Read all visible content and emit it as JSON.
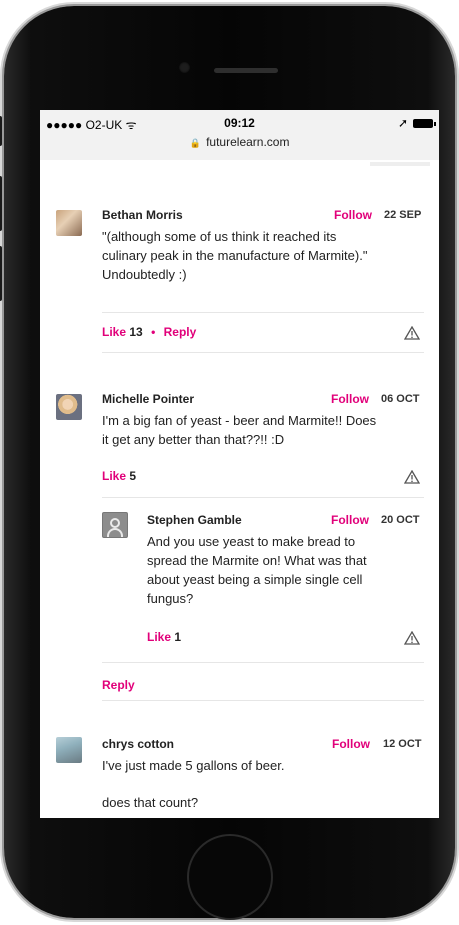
{
  "statusbar": {
    "carrier": "●●●●● O2-UK ᯤ",
    "time": "09:12",
    "location_arrow": "➚",
    "url": "futurelearn.com",
    "lock_icon": "lock-icon"
  },
  "comments": [
    {
      "name": "Bethan Morris",
      "follow": "Follow",
      "date": "22 SEP",
      "line1": "\"(although some of us think it reached its",
      "line2": "culinary peak in the manufacture of Marmite).\"",
      "line3": "Undoubtedly :)",
      "like": "Like",
      "like_count": "13",
      "reply": "Reply"
    },
    {
      "name": "Michelle Pointer",
      "follow": "Follow",
      "date": "06 OCT",
      "line1": "I'm a big fan of yeast - beer and Marmite!! Does",
      "line2": "it get any better than that??!! :D",
      "like": "Like",
      "like_count": "5",
      "reply_label": "Reply",
      "replies": [
        {
          "name": "Stephen Gamble",
          "follow": "Follow",
          "date": "20 OCT",
          "line1": "And you use yeast to make bread to",
          "line2": "spread the Marmite on! What was that",
          "line3": "about yeast being a simple single cell",
          "line4": "fungus?",
          "like": "Like",
          "like_count": "1"
        }
      ]
    },
    {
      "name": "chrys cotton",
      "follow": "Follow",
      "date": "12 OCT",
      "line1": "I've just made 5 gallons of beer.",
      "line2": "does that count?"
    }
  ],
  "colors": {
    "accent": "#e1007a",
    "text": "#222222",
    "divider": "#e6e6e6"
  }
}
